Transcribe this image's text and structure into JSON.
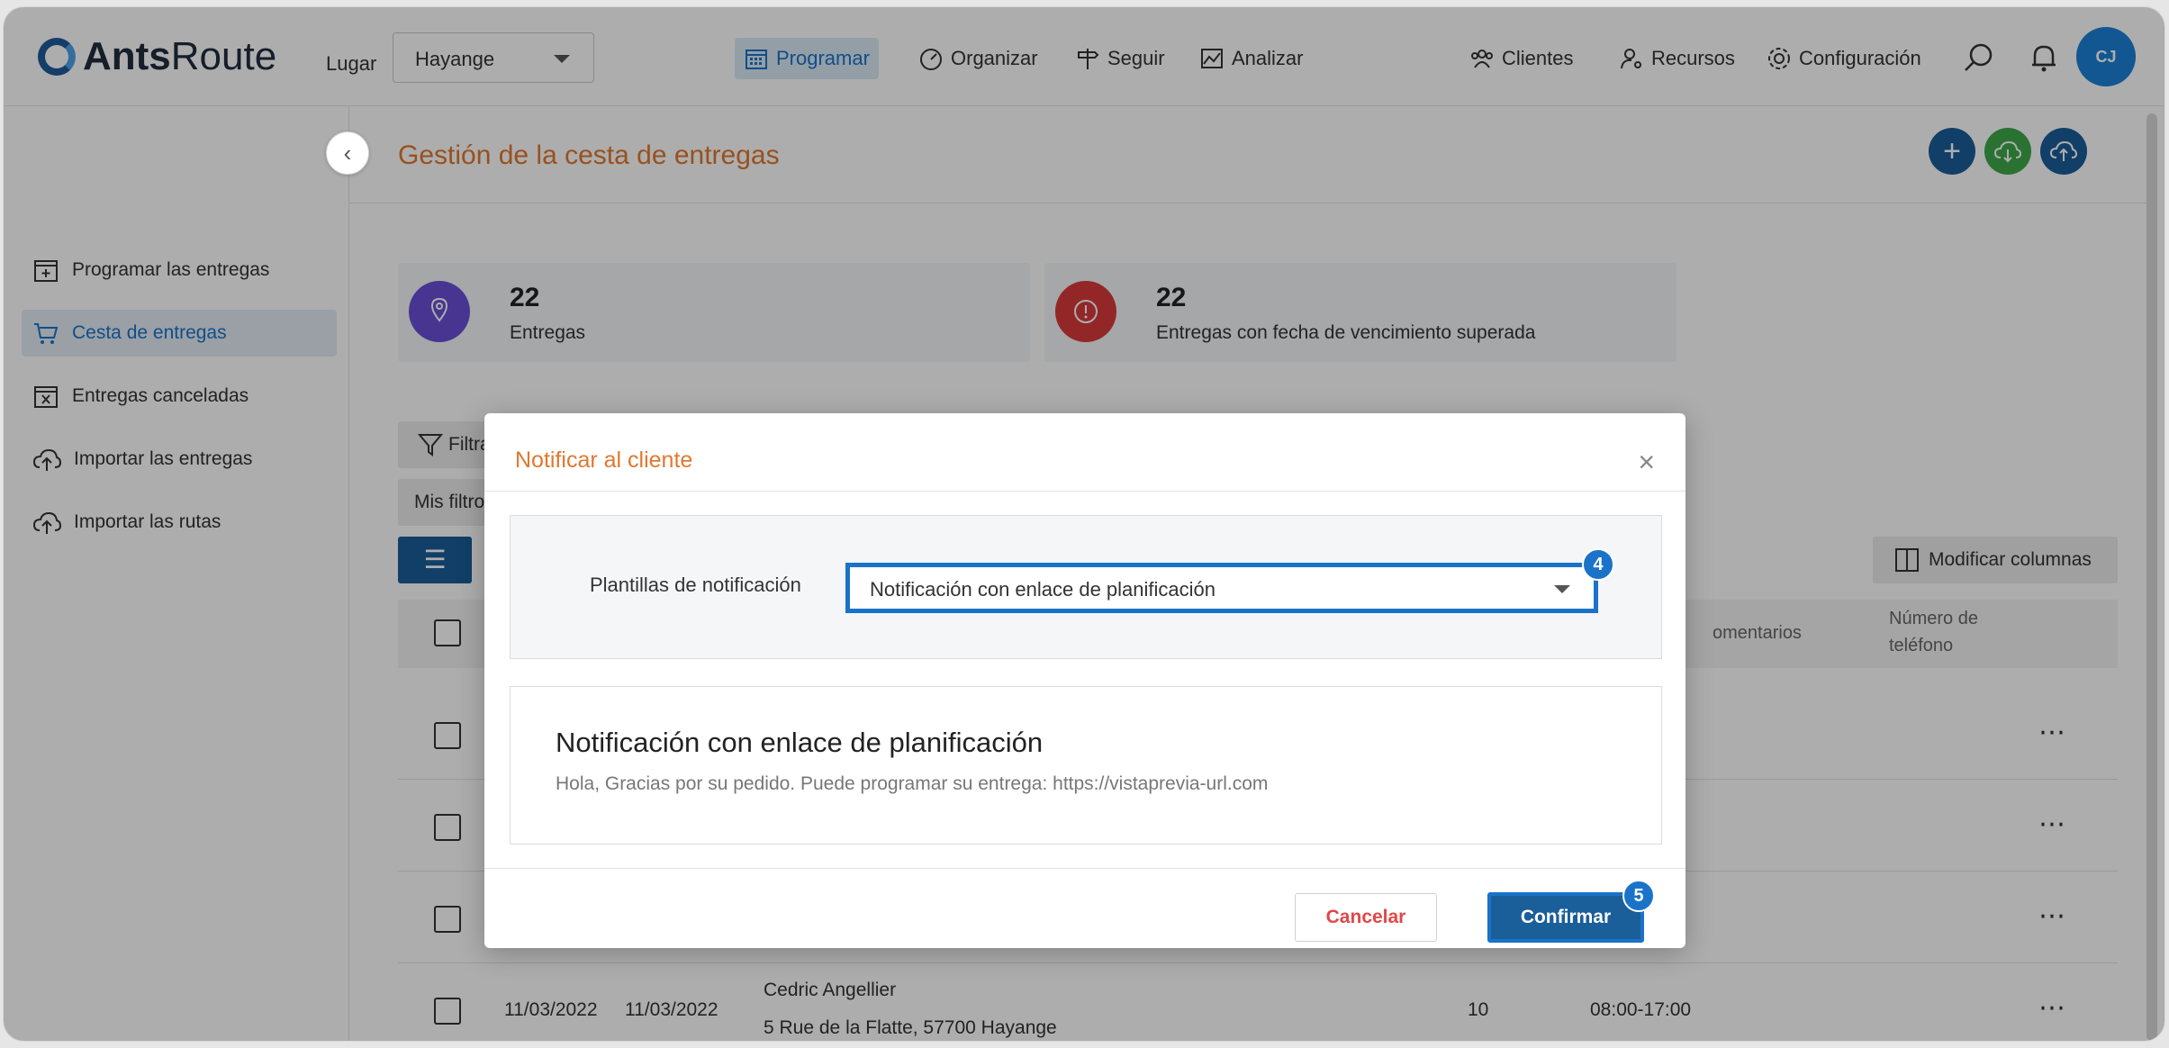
{
  "app": {
    "logo_bold": "Ants",
    "logo_light": "Route"
  },
  "topbar": {
    "place_label": "Lugar",
    "place_value": "Hayange",
    "nav": [
      "Programar",
      "Organizar",
      "Seguir",
      "Analizar"
    ],
    "right_nav": [
      "Clientes",
      "Recursos",
      "Configuración"
    ],
    "avatar_initials": "CJ"
  },
  "sidebar": {
    "items": [
      {
        "label": "Programar las entregas",
        "icon": "calendar-plus-icon"
      },
      {
        "label": "Cesta de entregas",
        "icon": "cart-icon",
        "active": true
      },
      {
        "label": "Entregas canceladas",
        "icon": "calendar-x-icon"
      },
      {
        "label": "Importar las entregas",
        "icon": "cloud-upload-icon"
      },
      {
        "label": "Importar las rutas",
        "icon": "cloud-upload-icon"
      }
    ]
  },
  "page": {
    "title": "Gestión de la cesta de entregas",
    "stats": [
      {
        "value": "22",
        "label": "Entregas",
        "color": "#6b4fd6"
      },
      {
        "value": "22",
        "label": "Entregas con fecha de vencimiento superada",
        "color": "#d93a3a"
      }
    ],
    "filter_label": "Filtra",
    "my_filters_label": "Mis filtro",
    "modify_columns_label": "Modificar columnas",
    "table": {
      "headers": [
        "omentarios",
        "Número de",
        "teléfono"
      ],
      "last_row": {
        "date1": "11/03/2022",
        "date2": "11/03/2022",
        "name": "Cedric Angellier",
        "address": "5 Rue de la Flatte, 57700 Hayange",
        "qty": "10",
        "window": "08:00-17:00"
      }
    }
  },
  "modal": {
    "title": "Notificar al cliente",
    "close": "×",
    "template_label": "Plantillas de notificación",
    "template_value": "Notificación con enlace de planificación",
    "template_badge": "4",
    "preview_title": "Notificación con enlace de planificación",
    "preview_body": "Hola, Gracias por su pedido. Puede programar su entrega:  https://vistaprevia-url.com",
    "cancel_label": "Cancelar",
    "confirm_label": "Confirmar",
    "confirm_badge": "5"
  },
  "colors": {
    "accent": "#1a73c8",
    "title_orange": "#e0782f",
    "primary_dark": "#1a5e9a",
    "danger": "#e04848"
  }
}
